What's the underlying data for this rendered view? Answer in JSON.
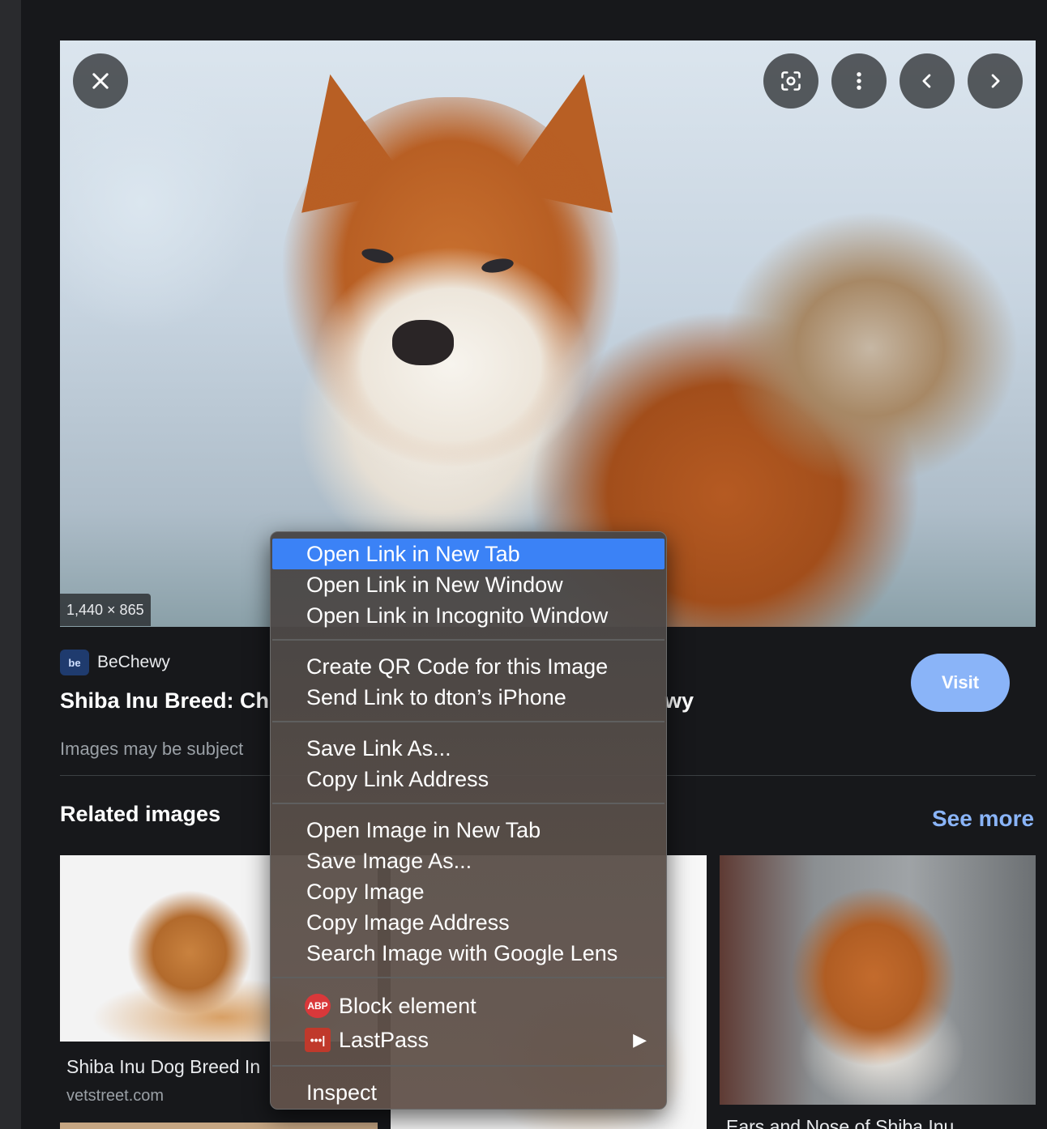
{
  "viewer": {
    "dimensions": "1,440 × 865",
    "icons": {
      "close": "close-icon",
      "lens": "lens-icon",
      "more": "more-vert-icon",
      "prev": "chevron-left-icon",
      "next": "chevron-right-icon"
    }
  },
  "result": {
    "source_logo_text": "be",
    "source_name": "BeChewy",
    "title_start": "Shiba Inu Breed: Ch",
    "title_end": "wy",
    "copyright": "Images may be subject",
    "visit_label": "Visit"
  },
  "related": {
    "heading": "Related images",
    "see_more": "See more",
    "items": [
      {
        "caption": "Shiba Inu Dog Breed In",
        "domain": "vetstreet.com"
      },
      {
        "caption": ""
      },
      {
        "caption": "Ears and Nose of Shiba Inu"
      }
    ]
  },
  "context_menu": {
    "groups": [
      [
        "Open Link in New Tab",
        "Open Link in New Window",
        "Open Link in Incognito Window"
      ],
      [
        "Create QR Code for this Image",
        "Send Link to dton’s iPhone"
      ],
      [
        "Save Link As...",
        "Copy Link Address"
      ],
      [
        "Open Image in New Tab",
        "Save Image As...",
        "Copy Image",
        "Copy Image Address",
        "Search Image with Google Lens"
      ],
      [
        "Block element",
        "LastPass"
      ],
      [
        "Inspect"
      ]
    ],
    "extension_icons": {
      "abp": "ABP",
      "lastpass": "•••|"
    },
    "submenu_arrow": "▶"
  },
  "colors": {
    "accent": "#8ab4f8",
    "menu_highlight": "#3b82f6",
    "background": "#17181b"
  }
}
